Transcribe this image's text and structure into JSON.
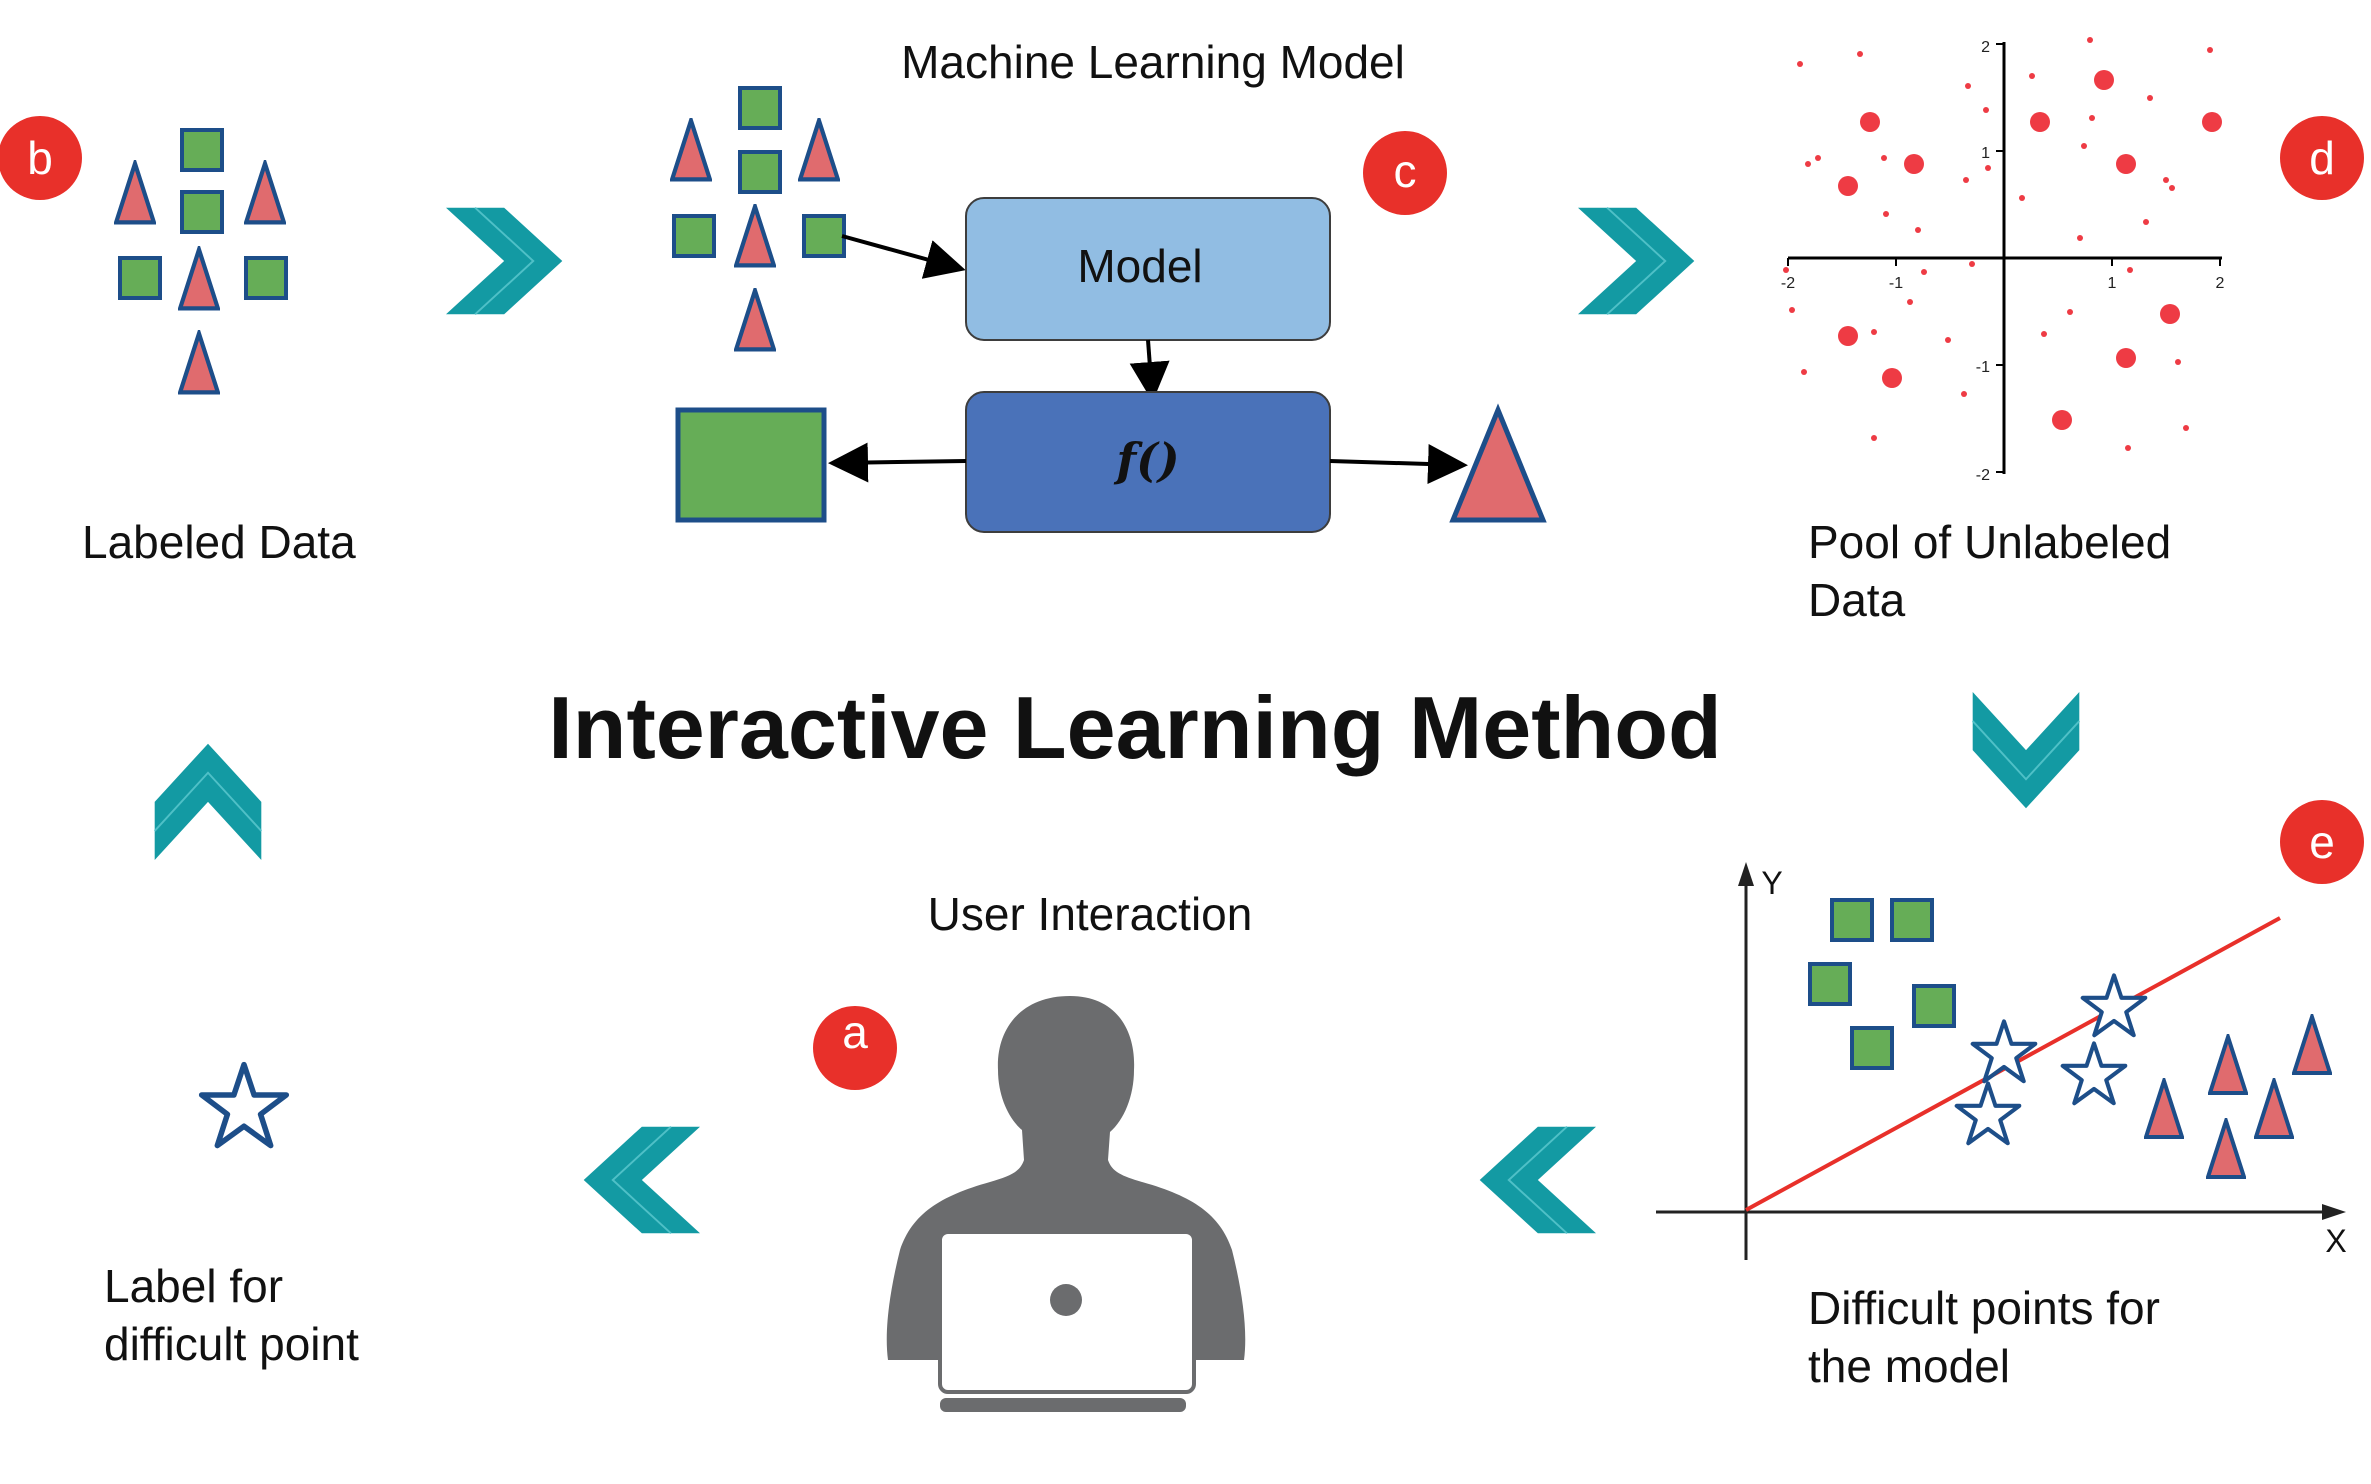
{
  "title": "Interactive Learning Method",
  "panels": {
    "labeled_data": {
      "badge": "b",
      "label_lines": [
        "Labeled Data"
      ]
    },
    "model": {
      "badge": "c",
      "heading": "Machine Learning Model",
      "model_box": "Model",
      "function_box": "f()"
    },
    "unlabeled_pool": {
      "badge": "d",
      "label_lines": [
        "Pool of Unlabeled",
        "Data"
      ],
      "x_ticks": [
        "-2",
        "-1",
        "1",
        "2"
      ],
      "y_ticks": [
        "2",
        "1",
        "-1",
        "-2"
      ]
    },
    "difficult_points": {
      "badge": "e",
      "label_lines": [
        "Difficult points for",
        "the model"
      ],
      "x_axis": "X",
      "y_axis": "Y"
    },
    "user_interaction": {
      "badge": "a",
      "heading": "User Interaction"
    },
    "label_difficult": {
      "label_lines": [
        "Label for",
        "difficult point"
      ]
    }
  },
  "colors": {
    "green": "#66ad57",
    "red_fill": "#e06b6e",
    "blue_outline": "#1d4e89",
    "arrow_teal": "#139aa3",
    "badge_red": "#e8302a",
    "model_box": "#91bde3",
    "function_box": "#4a72b9",
    "person_gray": "#6b6c6e",
    "scatter_red": "#ee3b44"
  }
}
